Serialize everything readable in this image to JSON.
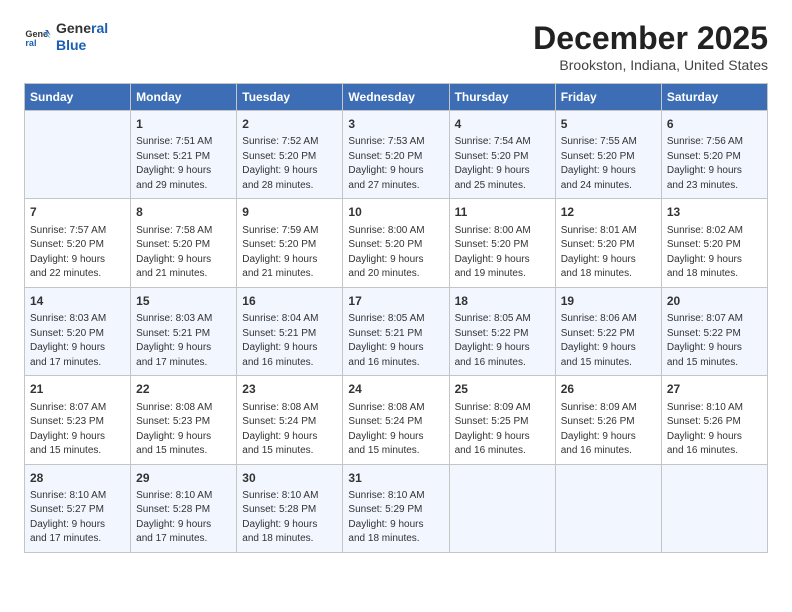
{
  "header": {
    "logo_line1": "General",
    "logo_line2": "Blue",
    "title": "December 2025",
    "subtitle": "Brookston, Indiana, United States"
  },
  "days_of_week": [
    "Sunday",
    "Monday",
    "Tuesday",
    "Wednesday",
    "Thursday",
    "Friday",
    "Saturday"
  ],
  "weeks": [
    [
      {
        "num": "",
        "info": ""
      },
      {
        "num": "1",
        "info": "Sunrise: 7:51 AM\nSunset: 5:21 PM\nDaylight: 9 hours\nand 29 minutes."
      },
      {
        "num": "2",
        "info": "Sunrise: 7:52 AM\nSunset: 5:20 PM\nDaylight: 9 hours\nand 28 minutes."
      },
      {
        "num": "3",
        "info": "Sunrise: 7:53 AM\nSunset: 5:20 PM\nDaylight: 9 hours\nand 27 minutes."
      },
      {
        "num": "4",
        "info": "Sunrise: 7:54 AM\nSunset: 5:20 PM\nDaylight: 9 hours\nand 25 minutes."
      },
      {
        "num": "5",
        "info": "Sunrise: 7:55 AM\nSunset: 5:20 PM\nDaylight: 9 hours\nand 24 minutes."
      },
      {
        "num": "6",
        "info": "Sunrise: 7:56 AM\nSunset: 5:20 PM\nDaylight: 9 hours\nand 23 minutes."
      }
    ],
    [
      {
        "num": "7",
        "info": "Sunrise: 7:57 AM\nSunset: 5:20 PM\nDaylight: 9 hours\nand 22 minutes."
      },
      {
        "num": "8",
        "info": "Sunrise: 7:58 AM\nSunset: 5:20 PM\nDaylight: 9 hours\nand 21 minutes."
      },
      {
        "num": "9",
        "info": "Sunrise: 7:59 AM\nSunset: 5:20 PM\nDaylight: 9 hours\nand 21 minutes."
      },
      {
        "num": "10",
        "info": "Sunrise: 8:00 AM\nSunset: 5:20 PM\nDaylight: 9 hours\nand 20 minutes."
      },
      {
        "num": "11",
        "info": "Sunrise: 8:00 AM\nSunset: 5:20 PM\nDaylight: 9 hours\nand 19 minutes."
      },
      {
        "num": "12",
        "info": "Sunrise: 8:01 AM\nSunset: 5:20 PM\nDaylight: 9 hours\nand 18 minutes."
      },
      {
        "num": "13",
        "info": "Sunrise: 8:02 AM\nSunset: 5:20 PM\nDaylight: 9 hours\nand 18 minutes."
      }
    ],
    [
      {
        "num": "14",
        "info": "Sunrise: 8:03 AM\nSunset: 5:20 PM\nDaylight: 9 hours\nand 17 minutes."
      },
      {
        "num": "15",
        "info": "Sunrise: 8:03 AM\nSunset: 5:21 PM\nDaylight: 9 hours\nand 17 minutes."
      },
      {
        "num": "16",
        "info": "Sunrise: 8:04 AM\nSunset: 5:21 PM\nDaylight: 9 hours\nand 16 minutes."
      },
      {
        "num": "17",
        "info": "Sunrise: 8:05 AM\nSunset: 5:21 PM\nDaylight: 9 hours\nand 16 minutes."
      },
      {
        "num": "18",
        "info": "Sunrise: 8:05 AM\nSunset: 5:22 PM\nDaylight: 9 hours\nand 16 minutes."
      },
      {
        "num": "19",
        "info": "Sunrise: 8:06 AM\nSunset: 5:22 PM\nDaylight: 9 hours\nand 15 minutes."
      },
      {
        "num": "20",
        "info": "Sunrise: 8:07 AM\nSunset: 5:22 PM\nDaylight: 9 hours\nand 15 minutes."
      }
    ],
    [
      {
        "num": "21",
        "info": "Sunrise: 8:07 AM\nSunset: 5:23 PM\nDaylight: 9 hours\nand 15 minutes."
      },
      {
        "num": "22",
        "info": "Sunrise: 8:08 AM\nSunset: 5:23 PM\nDaylight: 9 hours\nand 15 minutes."
      },
      {
        "num": "23",
        "info": "Sunrise: 8:08 AM\nSunset: 5:24 PM\nDaylight: 9 hours\nand 15 minutes."
      },
      {
        "num": "24",
        "info": "Sunrise: 8:08 AM\nSunset: 5:24 PM\nDaylight: 9 hours\nand 15 minutes."
      },
      {
        "num": "25",
        "info": "Sunrise: 8:09 AM\nSunset: 5:25 PM\nDaylight: 9 hours\nand 16 minutes."
      },
      {
        "num": "26",
        "info": "Sunrise: 8:09 AM\nSunset: 5:26 PM\nDaylight: 9 hours\nand 16 minutes."
      },
      {
        "num": "27",
        "info": "Sunrise: 8:10 AM\nSunset: 5:26 PM\nDaylight: 9 hours\nand 16 minutes."
      }
    ],
    [
      {
        "num": "28",
        "info": "Sunrise: 8:10 AM\nSunset: 5:27 PM\nDaylight: 9 hours\nand 17 minutes."
      },
      {
        "num": "29",
        "info": "Sunrise: 8:10 AM\nSunset: 5:28 PM\nDaylight: 9 hours\nand 17 minutes."
      },
      {
        "num": "30",
        "info": "Sunrise: 8:10 AM\nSunset: 5:28 PM\nDaylight: 9 hours\nand 18 minutes."
      },
      {
        "num": "31",
        "info": "Sunrise: 8:10 AM\nSunset: 5:29 PM\nDaylight: 9 hours\nand 18 minutes."
      },
      {
        "num": "",
        "info": ""
      },
      {
        "num": "",
        "info": ""
      },
      {
        "num": "",
        "info": ""
      }
    ]
  ]
}
